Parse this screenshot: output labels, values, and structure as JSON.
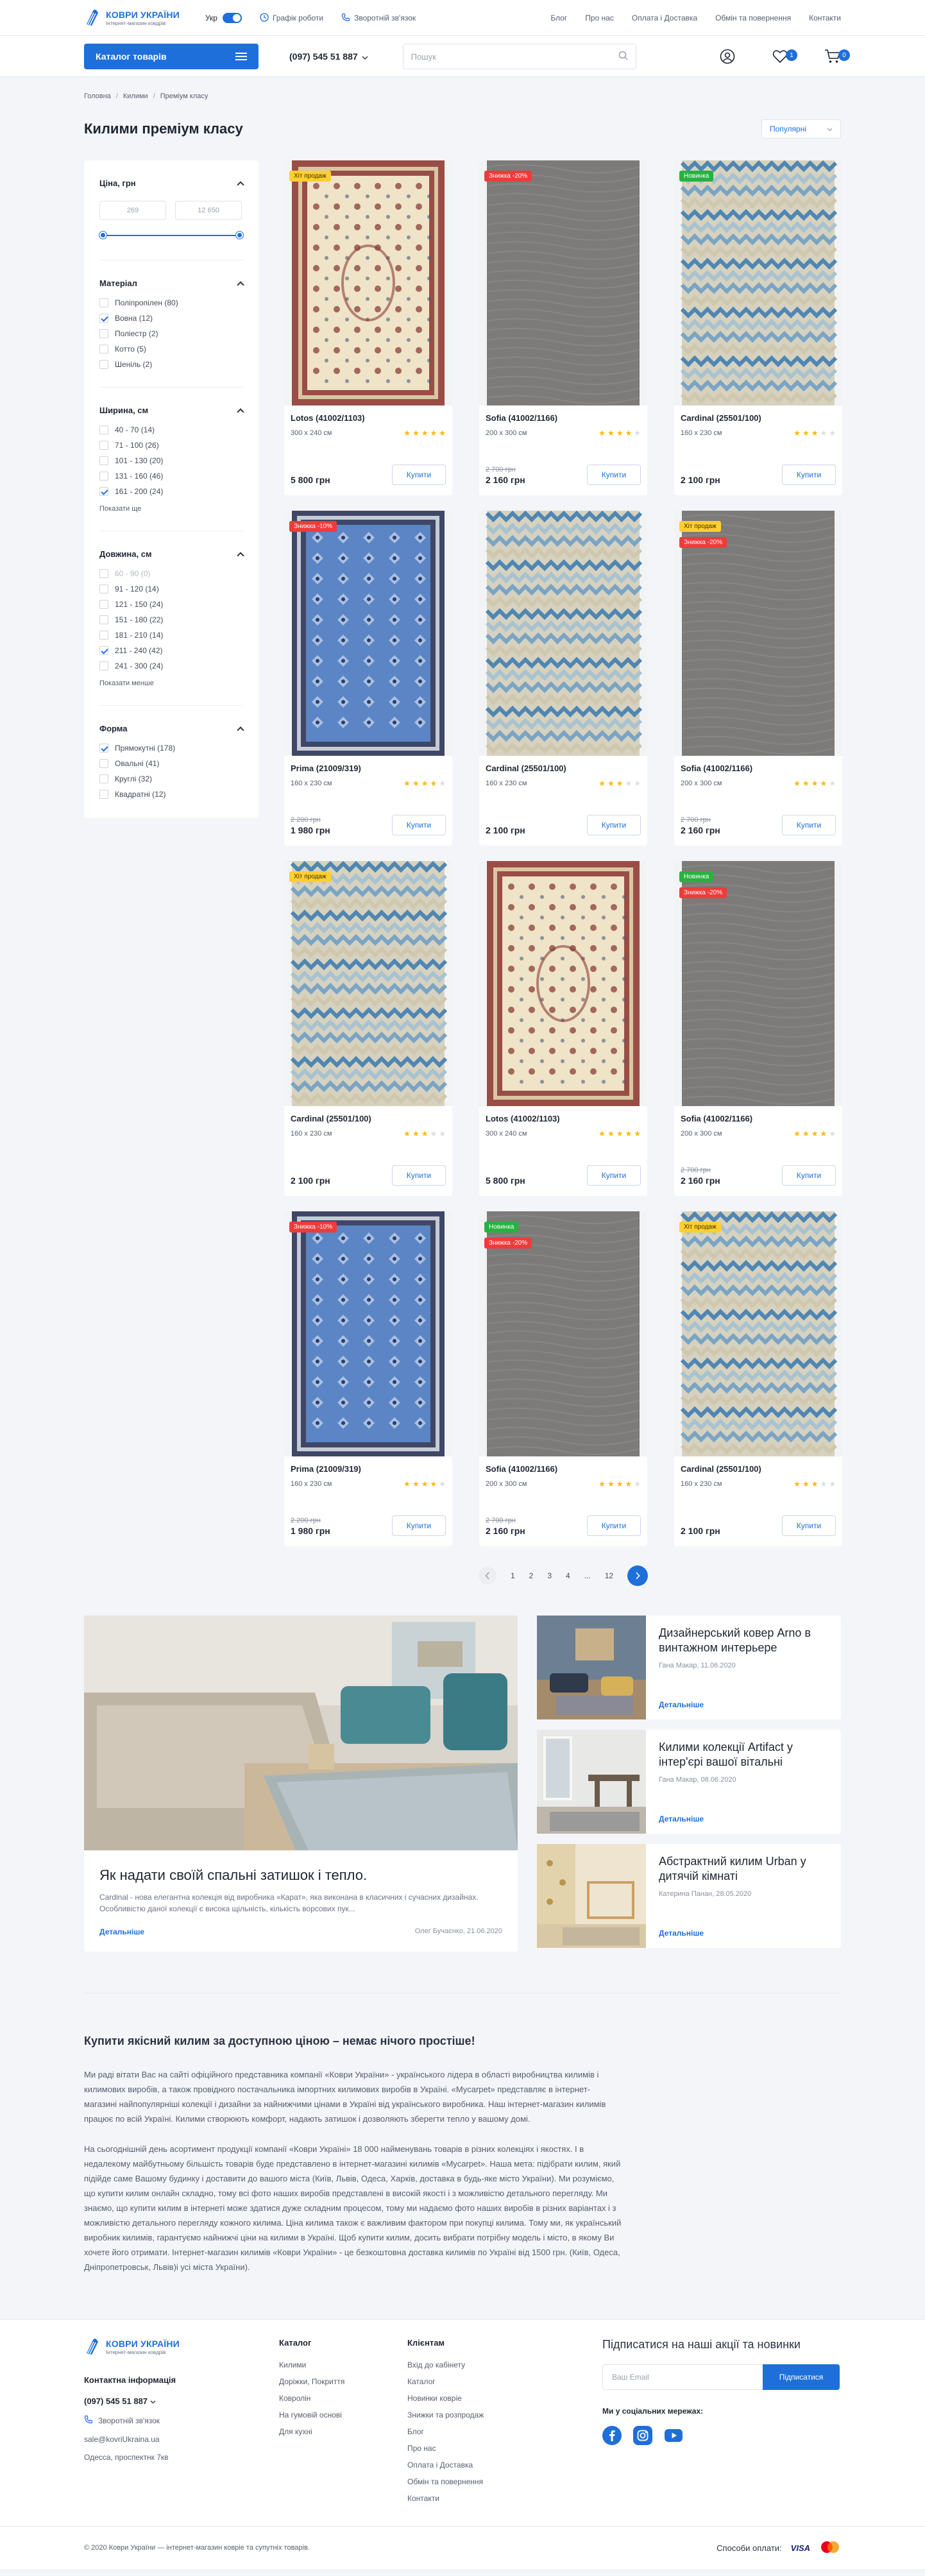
{
  "brand": {
    "title": "КОВРИ УКРАЇНИ",
    "subtitle": "Інтернет-магазин ковдрів"
  },
  "colors": {
    "accent": "#1e6fd9",
    "hit": "#ffcf2f",
    "sale": "#ef3b3b",
    "new": "#27b23f",
    "star": "#ffb800"
  },
  "topbar": {
    "lang": "Укр",
    "schedule": "Графік роботи",
    "callback": "Зворотній зв'язок",
    "nav": [
      "Блог",
      "Про нас",
      "Оплата і Доставка",
      "Обмін та повернення",
      "Контакти"
    ]
  },
  "header": {
    "catalog_btn": "Каталог товарів",
    "phone": "(097) 545 51 887",
    "search_placeholder": "Пошук",
    "wishlist_count": "1",
    "cart_count": "0"
  },
  "breadcrumb": [
    "Головна",
    "Килими",
    "Преміум класу"
  ],
  "page_title": "Килими преміум класу",
  "sort": "Популярні",
  "filters": {
    "price": {
      "title": "Ціна, грн",
      "min": "269",
      "max": "12 650"
    },
    "material": {
      "title": "Матеріал",
      "items": [
        {
          "label": "Поліпропілен (80)",
          "checked": false,
          "disabled": false
        },
        {
          "label": "Вовна (12)",
          "checked": true,
          "disabled": false
        },
        {
          "label": "Поліестр (2)",
          "checked": false,
          "disabled": false
        },
        {
          "label": "Котто (5)",
          "checked": false,
          "disabled": false
        },
        {
          "label": "Шеніль (2)",
          "checked": false,
          "disabled": false
        }
      ]
    },
    "width": {
      "title": "Ширина, см",
      "items": [
        {
          "label": "40 - 70 (14)",
          "checked": false,
          "disabled": false
        },
        {
          "label": "71 - 100 (26)",
          "checked": false,
          "disabled": false
        },
        {
          "label": "101 - 130 (20)",
          "checked": false,
          "disabled": false
        },
        {
          "label": "131 - 160 (46)",
          "checked": false,
          "disabled": false
        },
        {
          "label": "161 - 200 (24)",
          "checked": true,
          "disabled": false
        }
      ],
      "more": "Показати ще"
    },
    "length": {
      "title": "Довжина, см",
      "items": [
        {
          "label": "60 - 90 (0)",
          "checked": false,
          "disabled": true
        },
        {
          "label": "91 - 120 (14)",
          "checked": false,
          "disabled": false
        },
        {
          "label": "121 - 150 (24)",
          "checked": false,
          "disabled": false
        },
        {
          "label": "151 - 180 (22)",
          "checked": false,
          "disabled": false
        },
        {
          "label": "181 - 210 (14)",
          "checked": false,
          "disabled": false
        },
        {
          "label": "211 - 240 (42)",
          "checked": true,
          "disabled": false
        },
        {
          "label": "241 - 300 (24)",
          "checked": false,
          "disabled": false
        }
      ],
      "more": "Показати менше"
    },
    "shape": {
      "title": "Форма",
      "items": [
        {
          "label": "Прямокутні (178)",
          "checked": true,
          "disabled": false
        },
        {
          "label": "Овальні (41)",
          "checked": false,
          "disabled": false
        },
        {
          "label": "Круглі (32)",
          "checked": false,
          "disabled": false
        },
        {
          "label": "Квадратні (12)",
          "checked": false,
          "disabled": false
        }
      ]
    }
  },
  "buy_label": "Купити",
  "products": [
    {
      "name": "Lotos (41002/1103)",
      "size": "300 х 240 см",
      "rating": 5,
      "old_price": "",
      "price": "5 800 грн",
      "badges": [
        {
          "type": "hit",
          "label": "Хіт продаж"
        }
      ],
      "pattern": "lotos"
    },
    {
      "name": "Sofia (41002/1166)",
      "size": "200 х 300 см",
      "rating": 4,
      "old_price": "2 700 грн",
      "price": "2 160 грн",
      "badges": [
        {
          "type": "sale",
          "label": "Знижка -20%"
        }
      ],
      "pattern": "sofia"
    },
    {
      "name": "Cardinal (25501/100)",
      "size": "160 х 230 см",
      "rating": 3,
      "old_price": "",
      "price": "2 100 грн",
      "badges": [
        {
          "type": "new",
          "label": "Новинка"
        }
      ],
      "pattern": "cardinal"
    },
    {
      "name": "Prima (21009/319)",
      "size": "160 х 230 см",
      "rating": 4,
      "old_price": "2 200 грн",
      "price": "1 980 грн",
      "badges": [
        {
          "type": "sale",
          "label": "Знижка -10%"
        }
      ],
      "pattern": "prima"
    },
    {
      "name": "Cardinal (25501/100)",
      "size": "160 х 230 см",
      "rating": 3,
      "old_price": "",
      "price": "2 100 грн",
      "badges": [],
      "pattern": "cardinal"
    },
    {
      "name": "Sofia (41002/1166)",
      "size": "200 х 300 см",
      "rating": 4,
      "old_price": "2 700 грн",
      "price": "2 160 грн",
      "badges": [
        {
          "type": "hit",
          "label": "Хіт продаж"
        },
        {
          "type": "sale",
          "label": "Знижка -20%"
        }
      ],
      "pattern": "sofia"
    },
    {
      "name": "Cardinal (25501/100)",
      "size": "160 х 230 см",
      "rating": 3,
      "old_price": "",
      "price": "2 100 грн",
      "badges": [
        {
          "type": "hit",
          "label": "Хіт продаж"
        }
      ],
      "pattern": "cardinal"
    },
    {
      "name": "Lotos (41002/1103)",
      "size": "300 х 240 см",
      "rating": 5,
      "old_price": "",
      "price": "5 800 грн",
      "badges": [],
      "pattern": "lotos"
    },
    {
      "name": "Sofia (41002/1166)",
      "size": "200 х 300 см",
      "rating": 4,
      "old_price": "2 700 грн",
      "price": "2 160 грн",
      "badges": [
        {
          "type": "new",
          "label": "Новинка"
        },
        {
          "type": "sale",
          "label": "Знижка -20%"
        }
      ],
      "pattern": "sofia"
    },
    {
      "name": "Prima (21009/319)",
      "size": "160 х 230 см",
      "rating": 4,
      "old_price": "2 200 грн",
      "price": "1 980 грн",
      "badges": [
        {
          "type": "sale",
          "label": "Знижка -10%"
        }
      ],
      "pattern": "prima"
    },
    {
      "name": "Sofia (41002/1166)",
      "size": "200 х 300 см",
      "rating": 4,
      "old_price": "2 700 грн",
      "price": "2 160 грн",
      "badges": [
        {
          "type": "new",
          "label": "Новинка"
        },
        {
          "type": "sale",
          "label": "Знижка -20%"
        }
      ],
      "pattern": "sofia"
    },
    {
      "name": "Cardinal (25501/100)",
      "size": "160 х 230 см",
      "rating": 3,
      "old_price": "",
      "price": "2 100 грн",
      "badges": [
        {
          "type": "hit",
          "label": "Хіт продаж"
        }
      ],
      "pattern": "cardinal"
    }
  ],
  "pagination": {
    "pages": [
      "1",
      "2",
      "3",
      "4",
      "...",
      "12"
    ],
    "current": "1",
    "prev_icon": "chevron-left-icon",
    "next_icon": "chevron-right-icon"
  },
  "blog": {
    "main": {
      "title": "Як надати своїй спальні затишок і тепло.",
      "text": "Cardinal - нова елегантна колекція від виробника «Карат», яка виконана в класичних і сучасних дизайнах. Особливістю даної колекції є висока щільність, кількість ворсових пук...",
      "more": "Детальніше",
      "meta": "Олег Бучаєнко, 21.06.2020"
    },
    "items": [
      {
        "title": "Дизайнерський ковер Arno в винтажном интерьере",
        "meta": "Ганa Макар, 11.06.2020",
        "more": "Детальніше",
        "scene": "living"
      },
      {
        "title": "Килими колекції Artifact у інтер'єрі вашої вітальні",
        "meta": "Ганa Макар, 08.06.2020",
        "more": "Детальніше",
        "scene": "dining"
      },
      {
        "title": "Абстрактний килим Urban у дитячій кімнаті",
        "meta": "Катерина Панан, 28.05.2020",
        "more": "Детальніше",
        "scene": "kids"
      }
    ]
  },
  "seo": {
    "title": "Купити якісний килим за доступною ціною – немає нічого простіше!",
    "p1": "Ми раді вітати Вас на сайті офіційного представника компанії «Коври України» - українського лідера в області виробництва килимів і килимових виробів, а також провідного постачальника імпортних килимових виробів в Україні. «Mycarpet» представляє в інтернет-магазині найпопулярніші колекції і дизайни за найнижчими цінами в Україні від українського виробника. Наш інтернет-магазин килимів працює по всій Україні. Килими створюють комфорт, надають затишок і дозволяють зберегти тепло у вашому домі.",
    "p2": "На сьогоднішній день асортимент продукції компанії «Коври Україні» 18 000 найменувань товарів в різних колекціях і якостях. І в недалекому майбутньому більшість товарів буде представлено в інтернет-магазині килимів «Mycarpet». Наша мета: підібрати килим, який підійде саме Вашому будинку і доставити до вашого міста (Київ, Львів, Одеса, Харків, доставка в будь-яке місто України). Ми розуміємо, що купити килим онлайн складно, тому всі фото наших виробів представлені в високій якості і з можливістю детального перегляду. Ми знаємо, що купити килим в інтернеті може здатися дуже складним процесом, тому ми надаємо фото наших виробів в різних варіантах і з можливістю детального перегляду кожного килима. Ціна килима також є важливим фактором при покупці килима. Тому ми, як український виробник килимів, гарантуємо найнижчі ціни на килими в Україні. Щоб купити килим, досить вибрати потрібну модель і місто, в якому Ви хочете його отримати. Інтернет-магазин килимів «Коври України» - це безкоштовна доставка килимів по Україні від 1500 грн. (Київ, Одеса, Дніпропетровськ, Львів)і усі міста України)."
  },
  "footer": {
    "contact_head": "Контактна інформація",
    "phone": "(097) 545 51 887",
    "callback": "Зворотній зв'язок",
    "email": "sale@kovriUkraina.ua",
    "address": "Одесса, проспектнк 7кв",
    "catalog_head": "Каталог",
    "catalog_links": [
      "Килими",
      "Доріжки, Покриття",
      "Ковролін",
      "На гумовій основі",
      "Для кухні"
    ],
    "client_head": "Клієнтам",
    "client_links": [
      "Вхід до кабінету",
      "Каталог",
      "Новинки ковріе",
      "Знижки та розпродаж",
      "Блог",
      "Про нас",
      "Оплата і Доставка",
      "Обмін та повернення",
      "Контакти"
    ],
    "subscribe_title": "Підписатися на наші акції та новинки",
    "email_placeholder": "Ваш Email",
    "subscribe_btn": "Підписатися",
    "social_head": "Ми у соціальних мережах:",
    "socials": [
      "facebook-icon",
      "instagram-icon",
      "youtube-icon"
    ],
    "copyright": "© 2020 Коври України — інтернет-магазин ковріе та супутніх товарів.",
    "payment_label": "Способи оплати:",
    "payment_visa": "VISA"
  }
}
